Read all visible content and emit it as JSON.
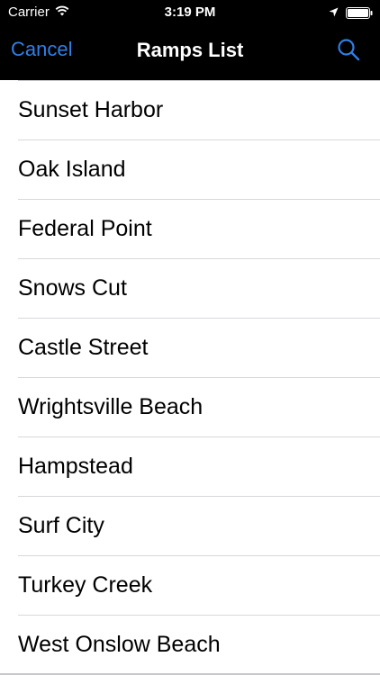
{
  "status_bar": {
    "carrier": "Carrier",
    "time": "3:19 PM",
    "icons": [
      "wifi-icon",
      "location-arrow-icon",
      "battery-icon"
    ]
  },
  "nav": {
    "cancel_label": "Cancel",
    "title": "Ramps List",
    "search_icon": "search-icon",
    "accent_color": "#2f7fe6"
  },
  "ramps": [
    "Sunset Harbor",
    "Oak Island",
    "Federal Point",
    "Snows Cut",
    "Castle Street",
    "Wrightsville Beach",
    "Hampstead",
    "Surf City",
    "Turkey Creek",
    "West Onslow Beach"
  ]
}
